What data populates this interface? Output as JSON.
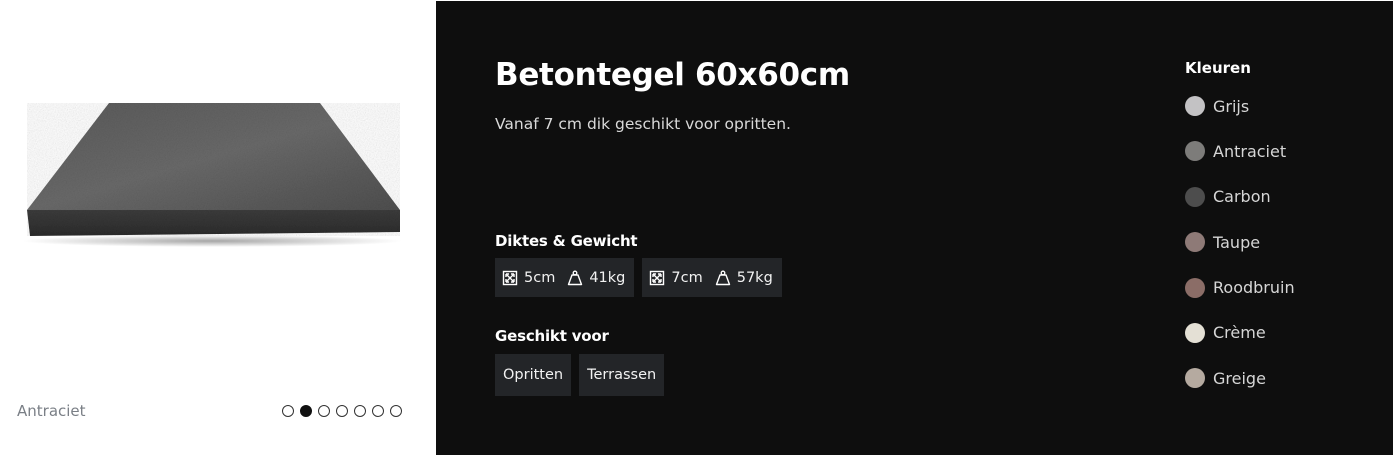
{
  "product": {
    "title": "Betontegel 60x60cm",
    "subtitle": "Vanaf 7 cm dik geschikt voor opritten."
  },
  "gallery": {
    "caption": "Antraciet",
    "dot_count": 7,
    "active_dot_index": 1
  },
  "specs": {
    "label": "Diktes & Gewicht",
    "items": [
      {
        "thickness": "5cm",
        "weight": "41kg"
      },
      {
        "thickness": "7cm",
        "weight": "57kg"
      }
    ]
  },
  "usage": {
    "label": "Geschikt voor",
    "items": [
      "Opritten",
      "Terrassen"
    ]
  },
  "colors": {
    "label": "Kleuren",
    "items": [
      {
        "name": "Grijs",
        "hex": "#c3c2c4"
      },
      {
        "name": "Antraciet",
        "hex": "#7d7c7a"
      },
      {
        "name": "Carbon",
        "hex": "#4d4d4d"
      },
      {
        "name": "Taupe",
        "hex": "#8e7a77"
      },
      {
        "name": "Roodbruin",
        "hex": "#8b6d67"
      },
      {
        "name": "Crème",
        "hex": "#e4e0d5"
      },
      {
        "name": "Greige",
        "hex": "#b5aaa0"
      }
    ]
  },
  "theme": {
    "panel_bg": "#0e0e0e",
    "chip_bg": "#232528"
  }
}
